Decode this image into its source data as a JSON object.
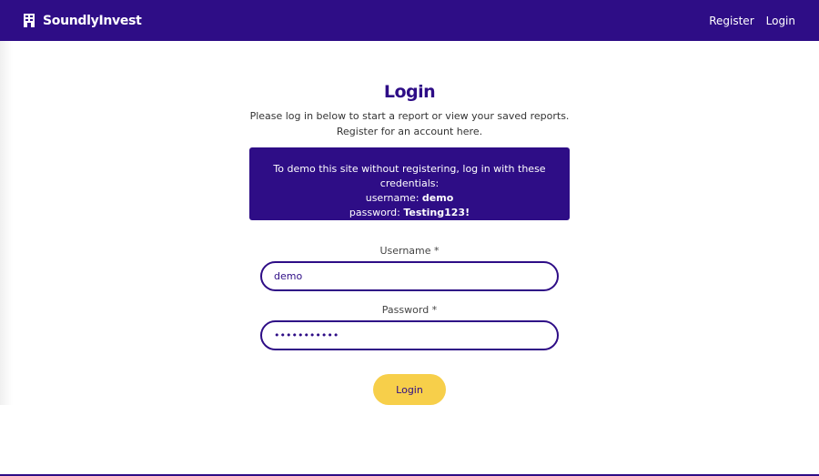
{
  "header": {
    "brand": "SoundlyInvest",
    "nav": [
      {
        "label": "Register"
      },
      {
        "label": "Login"
      }
    ]
  },
  "main": {
    "title": "Login",
    "subtitle_line1": "Please log in below to start a report or view your saved reports.",
    "subtitle_line2": "Register for an account here.",
    "demo": {
      "line1": "To demo this site without registering, log in with these credentials:",
      "username_label": "username:",
      "username_value": "demo",
      "password_label": "password:",
      "password_value": "Testing123!"
    },
    "form": {
      "username_label": "Username *",
      "username_value": "demo",
      "password_label": "Password *",
      "password_value": "Testing123!",
      "submit_label": "Login"
    }
  },
  "colors": {
    "brand": "#2e0d86",
    "button": "#f7cf4a"
  }
}
